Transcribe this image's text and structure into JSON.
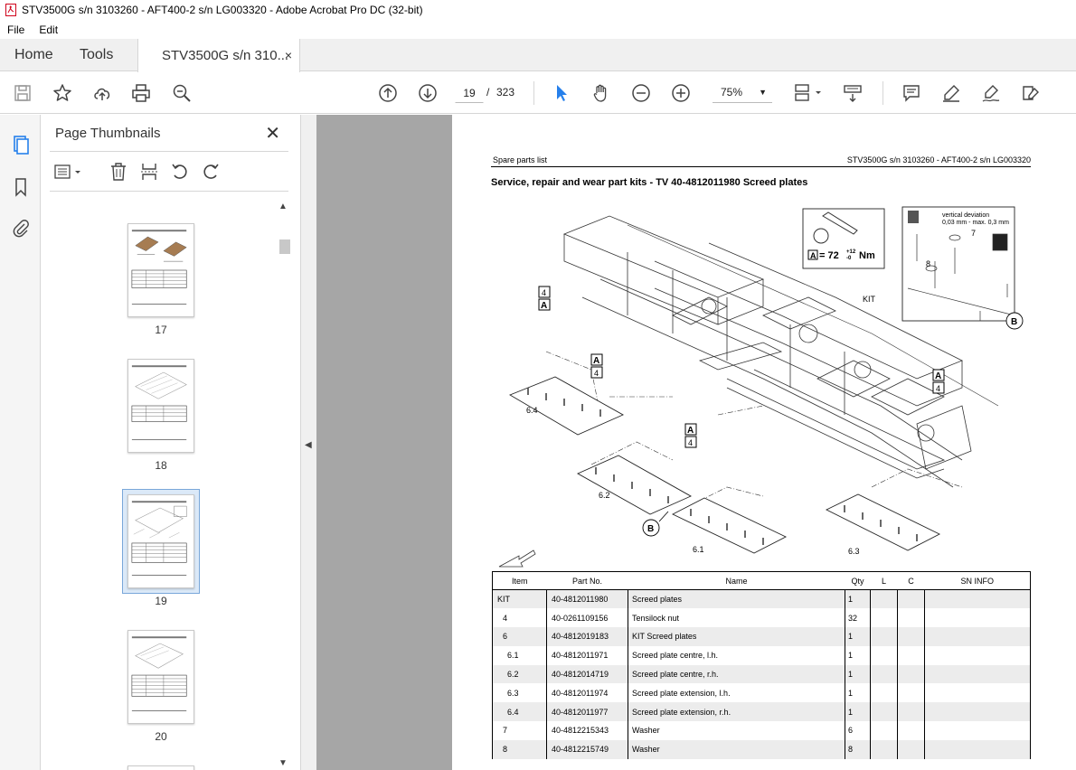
{
  "window": {
    "title": "STV3500G s/n 3103260 - AFT400-2 s/n LG003320 - Adobe Acrobat Pro DC (32-bit)"
  },
  "menu": [
    "File",
    "Edit"
  ],
  "tabs": {
    "home": "Home",
    "tools": "Tools",
    "document": "STV3500G s/n 310...",
    "close": "×"
  },
  "toolbar": {
    "current_page": "19",
    "page_sep": "/",
    "total_pages": "323",
    "zoom": "75%"
  },
  "thumbnails_panel": {
    "title": "Page Thumbnails",
    "pages": [
      "17",
      "18",
      "19",
      "20"
    ],
    "selected_page": "19"
  },
  "page": {
    "header_left": "Spare parts list",
    "header_right": "STV3500G s/n 3103260 - AFT400-2 s/n LG003320",
    "heading": "Service, repair and wear part kits - TV 40-4812011980 Screed plates",
    "drawing_labels": {
      "kit": "KIT",
      "torque_prefix": "A",
      "torque": "= 72",
      "torque_tol_up": "+12",
      "torque_tol_down": "-0",
      "torque_unit": "Nm",
      "deviation_title": "vertical deviation",
      "deviation_range": "0,03 mm - max. 0,3 mm",
      "callout_4": "4",
      "callout_a": "A",
      "callout_b": "B",
      "callout_7": "7",
      "callout_8": "8",
      "plate_61": "6.1",
      "plate_62": "6.2",
      "plate_63": "6.3",
      "plate_64": "6.4"
    },
    "table": {
      "headers": [
        "Item",
        "Part No.",
        "Name",
        "Qty",
        "L",
        "C",
        "SN INFO"
      ],
      "rows": [
        {
          "item": "KIT",
          "part": "40-4812011980",
          "name": "Screed plates",
          "qty": "1"
        },
        {
          "item": "4",
          "part": "40-0261109156",
          "name": "Tensilock nut",
          "qty": "32"
        },
        {
          "item": "6",
          "part": "40-4812019183",
          "name": "KIT Screed plates",
          "qty": "1"
        },
        {
          "item": "6.1",
          "part": "40-4812011971",
          "name": "Screed plate centre, l.h.",
          "qty": "1"
        },
        {
          "item": "6.2",
          "part": "40-4812014719",
          "name": "Screed plate centre, r.h.",
          "qty": "1"
        },
        {
          "item": "6.3",
          "part": "40-4812011974",
          "name": "Screed plate extension, l.h.",
          "qty": "1"
        },
        {
          "item": "6.4",
          "part": "40-4812011977",
          "name": "Screed plate extension, r.h.",
          "qty": "1"
        },
        {
          "item": "7",
          "part": "40-4812215343",
          "name": "Washer",
          "qty": "6"
        },
        {
          "item": "8",
          "part": "40-4812215749",
          "name": "Washer",
          "qty": "8"
        }
      ]
    }
  },
  "colors": {
    "accent": "#2680eb",
    "selection_bg": "#dbe9f8",
    "canvas_bg": "#a6a6a6"
  }
}
